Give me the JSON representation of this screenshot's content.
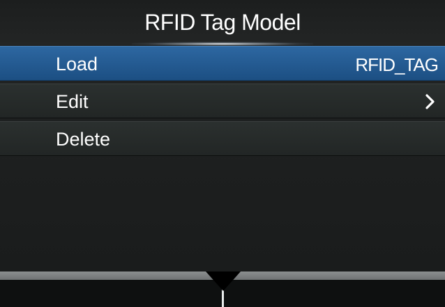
{
  "header": {
    "title": "RFID Tag Model"
  },
  "menu": {
    "items": [
      {
        "label": "Load",
        "value": "RFID_TAG",
        "selected": true
      },
      {
        "label": "Edit",
        "icon": "chevron-right-icon",
        "selected": false
      },
      {
        "label": "Delete",
        "selected": false
      }
    ]
  },
  "footer": {
    "indicator_icon": "down-arrow-icon",
    "divider_color": "#e9ecec"
  },
  "colors": {
    "background": "#1e2020",
    "selected_row": "#245c93",
    "row": "#262a29",
    "text": "#ffffff"
  }
}
